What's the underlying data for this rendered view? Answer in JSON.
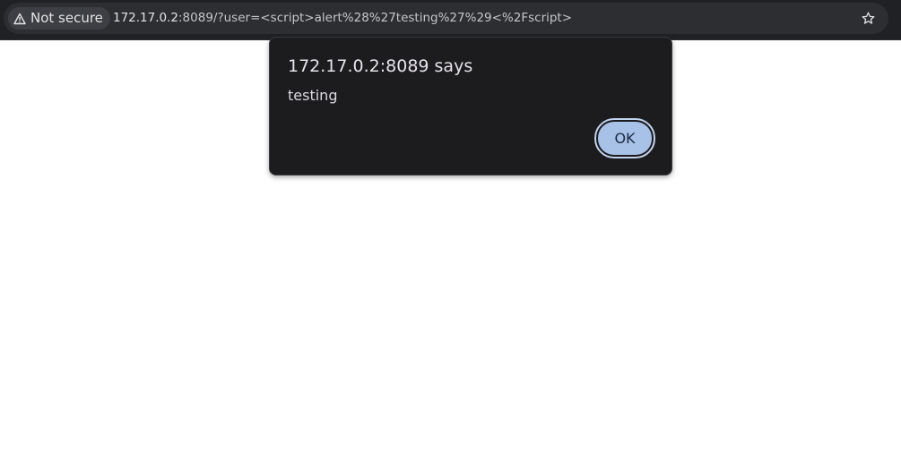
{
  "browser": {
    "security_chip": {
      "icon": "warning-triangle-icon",
      "label": "Not secure"
    },
    "url": {
      "host": "172.17.0.2",
      "rest": ":8089/?user=<script>alert%28%27testing%27%29<%2Fscript>"
    },
    "bookmark_icon": "star-outline-icon"
  },
  "dialog": {
    "title": "172.17.0.2:8089 says",
    "message": "testing",
    "ok_label": "OK"
  },
  "colors": {
    "toolbar_bg": "#1f2124",
    "omnibox_bg": "#2c2e32",
    "dialog_bg": "#1c1b1e",
    "ok_button_fill": "#a8c1e6",
    "page_bg": "#ffffff"
  }
}
